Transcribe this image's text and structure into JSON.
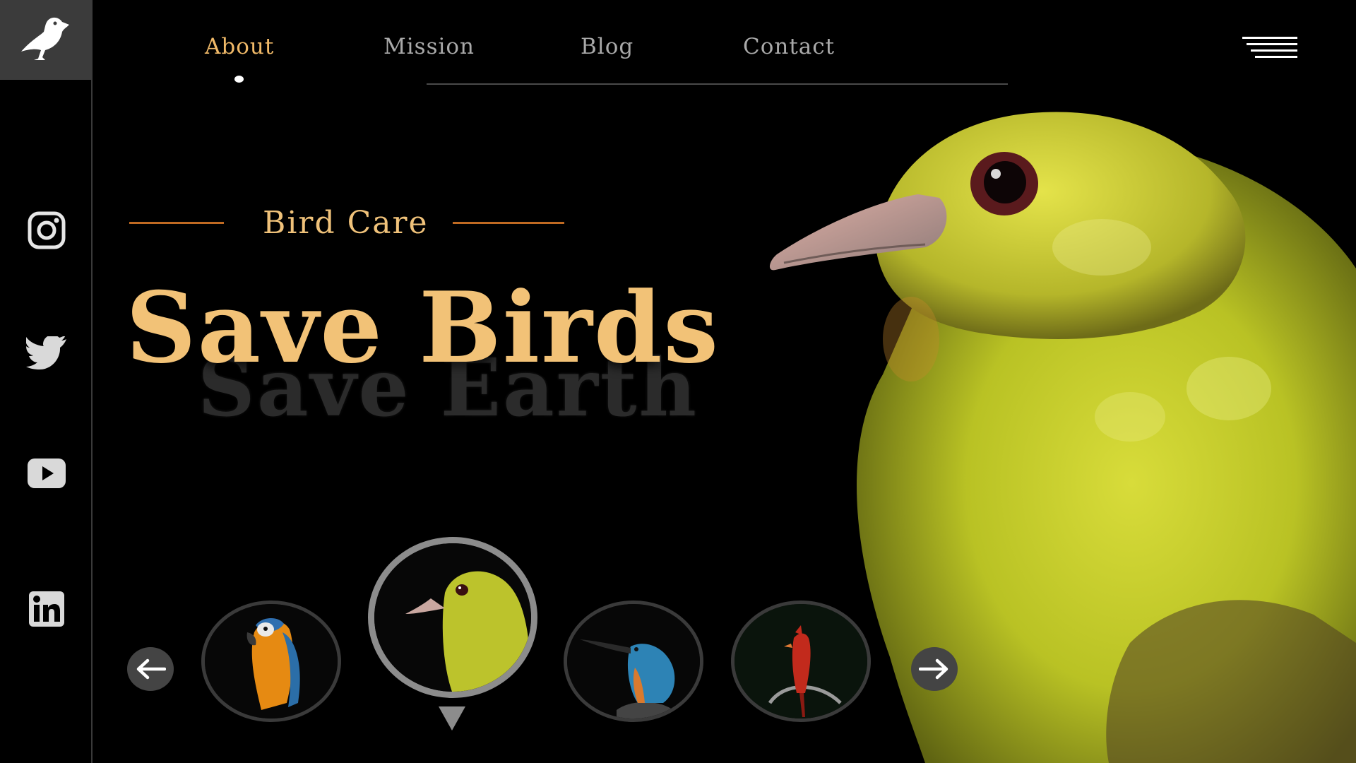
{
  "brand": {
    "logo_icon": "bird-logo-icon",
    "logo_bg": "#3b3b3b"
  },
  "social": [
    {
      "name": "instagram-icon"
    },
    {
      "name": "twitter-icon"
    },
    {
      "name": "youtube-icon"
    },
    {
      "name": "linkedin-icon"
    }
  ],
  "nav": {
    "items": [
      {
        "label": "About",
        "active": true
      },
      {
        "label": "Mission",
        "active": false
      },
      {
        "label": "Blog",
        "active": false
      },
      {
        "label": "Contact",
        "active": false
      }
    ],
    "menu_icon": "hamburger-menu-icon"
  },
  "hero": {
    "kicker": "Bird Care",
    "headline": "Save Birds",
    "subheadline": "Save Earth",
    "image": "yellow-bird-image"
  },
  "carousel": {
    "prev_icon": "arrow-left-icon",
    "next_icon": "arrow-right-icon",
    "selected_index": 1,
    "thumbnails": [
      {
        "name": "macaw-thumbnail"
      },
      {
        "name": "yellow-bird-thumbnail"
      },
      {
        "name": "kingfisher-thumbnail"
      },
      {
        "name": "cardinal-thumbnail"
      }
    ]
  },
  "colors": {
    "accent": "#f0c27a",
    "rule": "#c06a22",
    "nav_inactive": "#a9a9a9",
    "background": "#000000"
  }
}
